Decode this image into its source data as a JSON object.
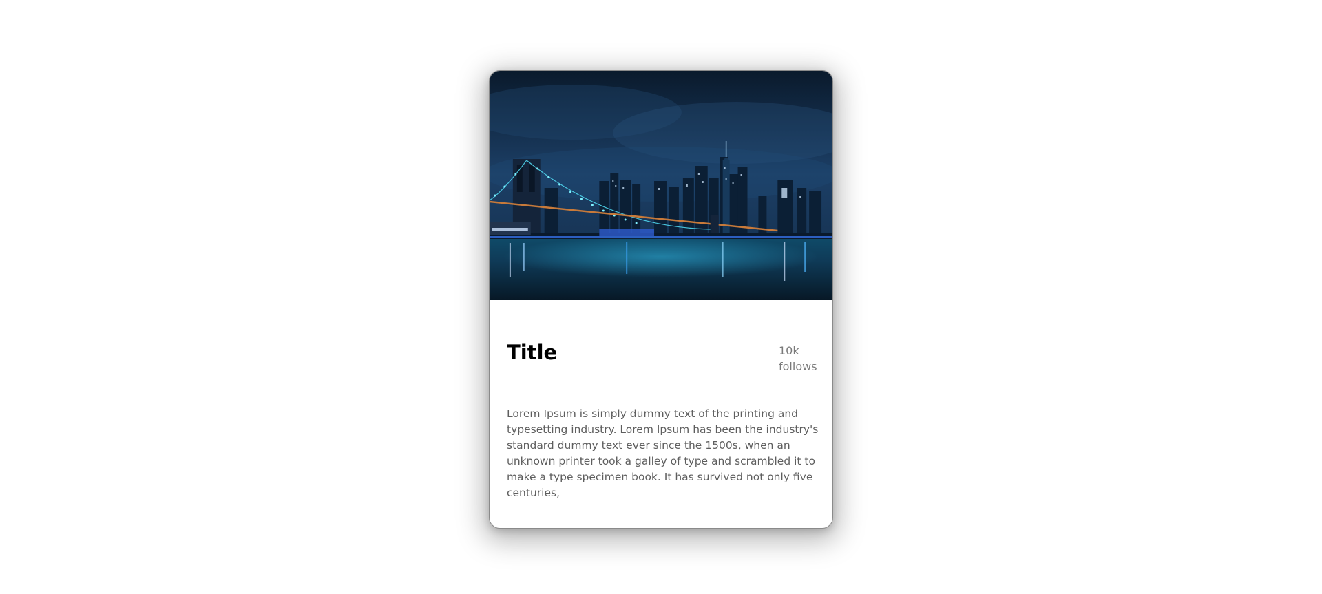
{
  "card": {
    "image_alt": "Brooklyn Bridge and city skyline at night",
    "title": "Title",
    "follows": "10k follows",
    "description": "Lorem Ipsum is simply dummy text of the printing and typesetting industry. Lorem Ipsum has been the industry's standard dummy text ever since the 1500s, when an unknown printer took a galley of type and scrambled it to make a type specimen book. It has survived not only five centuries,"
  },
  "colors": {
    "title": "#000000",
    "follows": "#7a7a7a",
    "description": "#5e5e5e",
    "card_border": "#8a8a8a"
  }
}
